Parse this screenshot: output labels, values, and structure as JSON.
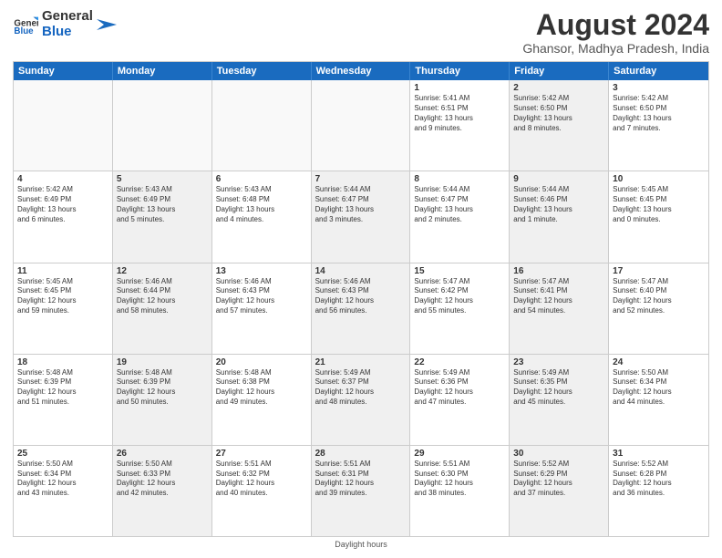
{
  "header": {
    "logo_general": "General",
    "logo_blue": "Blue",
    "main_title": "August 2024",
    "sub_title": "Ghansor, Madhya Pradesh, India"
  },
  "days_of_week": [
    "Sunday",
    "Monday",
    "Tuesday",
    "Wednesday",
    "Thursday",
    "Friday",
    "Saturday"
  ],
  "footer": {
    "note": "Daylight hours"
  },
  "weeks": [
    [
      {
        "day": "",
        "info": "",
        "empty": true
      },
      {
        "day": "",
        "info": "",
        "empty": true
      },
      {
        "day": "",
        "info": "",
        "empty": true
      },
      {
        "day": "",
        "info": "",
        "empty": true
      },
      {
        "day": "1",
        "info": "Sunrise: 5:41 AM\nSunset: 6:51 PM\nDaylight: 13 hours\nand 9 minutes.",
        "empty": false
      },
      {
        "day": "2",
        "info": "Sunrise: 5:42 AM\nSunset: 6:50 PM\nDaylight: 13 hours\nand 8 minutes.",
        "empty": false,
        "shaded": true
      },
      {
        "day": "3",
        "info": "Sunrise: 5:42 AM\nSunset: 6:50 PM\nDaylight: 13 hours\nand 7 minutes.",
        "empty": false
      }
    ],
    [
      {
        "day": "4",
        "info": "Sunrise: 5:42 AM\nSunset: 6:49 PM\nDaylight: 13 hours\nand 6 minutes.",
        "empty": false
      },
      {
        "day": "5",
        "info": "Sunrise: 5:43 AM\nSunset: 6:49 PM\nDaylight: 13 hours\nand 5 minutes.",
        "empty": false,
        "shaded": true
      },
      {
        "day": "6",
        "info": "Sunrise: 5:43 AM\nSunset: 6:48 PM\nDaylight: 13 hours\nand 4 minutes.",
        "empty": false
      },
      {
        "day": "7",
        "info": "Sunrise: 5:44 AM\nSunset: 6:47 PM\nDaylight: 13 hours\nand 3 minutes.",
        "empty": false,
        "shaded": true
      },
      {
        "day": "8",
        "info": "Sunrise: 5:44 AM\nSunset: 6:47 PM\nDaylight: 13 hours\nand 2 minutes.",
        "empty": false
      },
      {
        "day": "9",
        "info": "Sunrise: 5:44 AM\nSunset: 6:46 PM\nDaylight: 13 hours\nand 1 minute.",
        "empty": false,
        "shaded": true
      },
      {
        "day": "10",
        "info": "Sunrise: 5:45 AM\nSunset: 6:45 PM\nDaylight: 13 hours\nand 0 minutes.",
        "empty": false
      }
    ],
    [
      {
        "day": "11",
        "info": "Sunrise: 5:45 AM\nSunset: 6:45 PM\nDaylight: 12 hours\nand 59 minutes.",
        "empty": false
      },
      {
        "day": "12",
        "info": "Sunrise: 5:46 AM\nSunset: 6:44 PM\nDaylight: 12 hours\nand 58 minutes.",
        "empty": false,
        "shaded": true
      },
      {
        "day": "13",
        "info": "Sunrise: 5:46 AM\nSunset: 6:43 PM\nDaylight: 12 hours\nand 57 minutes.",
        "empty": false
      },
      {
        "day": "14",
        "info": "Sunrise: 5:46 AM\nSunset: 6:43 PM\nDaylight: 12 hours\nand 56 minutes.",
        "empty": false,
        "shaded": true
      },
      {
        "day": "15",
        "info": "Sunrise: 5:47 AM\nSunset: 6:42 PM\nDaylight: 12 hours\nand 55 minutes.",
        "empty": false
      },
      {
        "day": "16",
        "info": "Sunrise: 5:47 AM\nSunset: 6:41 PM\nDaylight: 12 hours\nand 54 minutes.",
        "empty": false,
        "shaded": true
      },
      {
        "day": "17",
        "info": "Sunrise: 5:47 AM\nSunset: 6:40 PM\nDaylight: 12 hours\nand 52 minutes.",
        "empty": false
      }
    ],
    [
      {
        "day": "18",
        "info": "Sunrise: 5:48 AM\nSunset: 6:39 PM\nDaylight: 12 hours\nand 51 minutes.",
        "empty": false
      },
      {
        "day": "19",
        "info": "Sunrise: 5:48 AM\nSunset: 6:39 PM\nDaylight: 12 hours\nand 50 minutes.",
        "empty": false,
        "shaded": true
      },
      {
        "day": "20",
        "info": "Sunrise: 5:48 AM\nSunset: 6:38 PM\nDaylight: 12 hours\nand 49 minutes.",
        "empty": false
      },
      {
        "day": "21",
        "info": "Sunrise: 5:49 AM\nSunset: 6:37 PM\nDaylight: 12 hours\nand 48 minutes.",
        "empty": false,
        "shaded": true
      },
      {
        "day": "22",
        "info": "Sunrise: 5:49 AM\nSunset: 6:36 PM\nDaylight: 12 hours\nand 47 minutes.",
        "empty": false
      },
      {
        "day": "23",
        "info": "Sunrise: 5:49 AM\nSunset: 6:35 PM\nDaylight: 12 hours\nand 45 minutes.",
        "empty": false,
        "shaded": true
      },
      {
        "day": "24",
        "info": "Sunrise: 5:50 AM\nSunset: 6:34 PM\nDaylight: 12 hours\nand 44 minutes.",
        "empty": false
      }
    ],
    [
      {
        "day": "25",
        "info": "Sunrise: 5:50 AM\nSunset: 6:34 PM\nDaylight: 12 hours\nand 43 minutes.",
        "empty": false
      },
      {
        "day": "26",
        "info": "Sunrise: 5:50 AM\nSunset: 6:33 PM\nDaylight: 12 hours\nand 42 minutes.",
        "empty": false,
        "shaded": true
      },
      {
        "day": "27",
        "info": "Sunrise: 5:51 AM\nSunset: 6:32 PM\nDaylight: 12 hours\nand 40 minutes.",
        "empty": false
      },
      {
        "day": "28",
        "info": "Sunrise: 5:51 AM\nSunset: 6:31 PM\nDaylight: 12 hours\nand 39 minutes.",
        "empty": false,
        "shaded": true
      },
      {
        "day": "29",
        "info": "Sunrise: 5:51 AM\nSunset: 6:30 PM\nDaylight: 12 hours\nand 38 minutes.",
        "empty": false
      },
      {
        "day": "30",
        "info": "Sunrise: 5:52 AM\nSunset: 6:29 PM\nDaylight: 12 hours\nand 37 minutes.",
        "empty": false,
        "shaded": true
      },
      {
        "day": "31",
        "info": "Sunrise: 5:52 AM\nSunset: 6:28 PM\nDaylight: 12 hours\nand 36 minutes.",
        "empty": false
      }
    ]
  ]
}
